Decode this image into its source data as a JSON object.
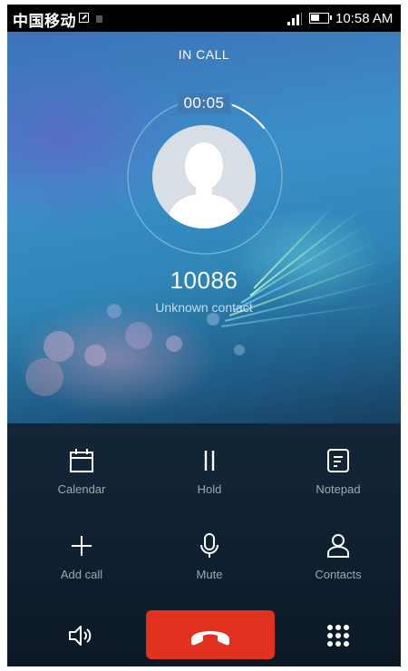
{
  "status_bar": {
    "carrier": "中国移动",
    "time": "10:58 AM"
  },
  "call": {
    "state_label": "IN CALL",
    "timer": "00:05",
    "number": "10086",
    "contact_label": "Unknown contact"
  },
  "controls": [
    {
      "label": "Calendar",
      "icon": "calendar-icon"
    },
    {
      "label": "Hold",
      "icon": "pause-icon"
    },
    {
      "label": "Notepad",
      "icon": "notepad-icon"
    },
    {
      "label": "Add call",
      "icon": "plus-icon"
    },
    {
      "label": "Mute",
      "icon": "microphone-icon"
    },
    {
      "label": "Contacts",
      "icon": "person-icon"
    }
  ],
  "bottom_bar": {
    "speaker_icon": "speaker-icon",
    "end_call_icon": "phone-hangup-icon",
    "keypad_icon": "dialpad-icon",
    "end_call_color": "#e0321f"
  },
  "colors": {
    "panel_bg": "#0f1f2f",
    "accent_text": "#ffffff",
    "secondary_text": "#a9b4bf"
  }
}
